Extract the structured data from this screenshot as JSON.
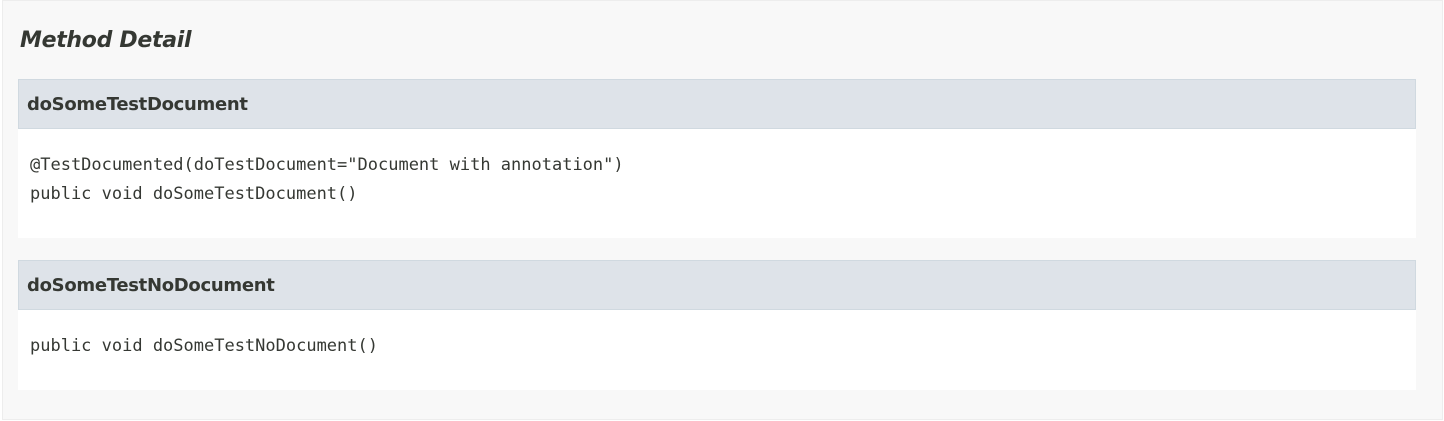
{
  "section": {
    "title": "Method Detail"
  },
  "methods": [
    {
      "name": "doSomeTestDocument",
      "signature_lines": [
        "@TestDocumented(doTestDocument=\"Document with annotation\")",
        "public void doSomeTestDocument()"
      ]
    },
    {
      "name": "doSomeTestNoDocument",
      "signature_lines": [
        "public void doSomeTestNoDocument()"
      ]
    }
  ]
}
